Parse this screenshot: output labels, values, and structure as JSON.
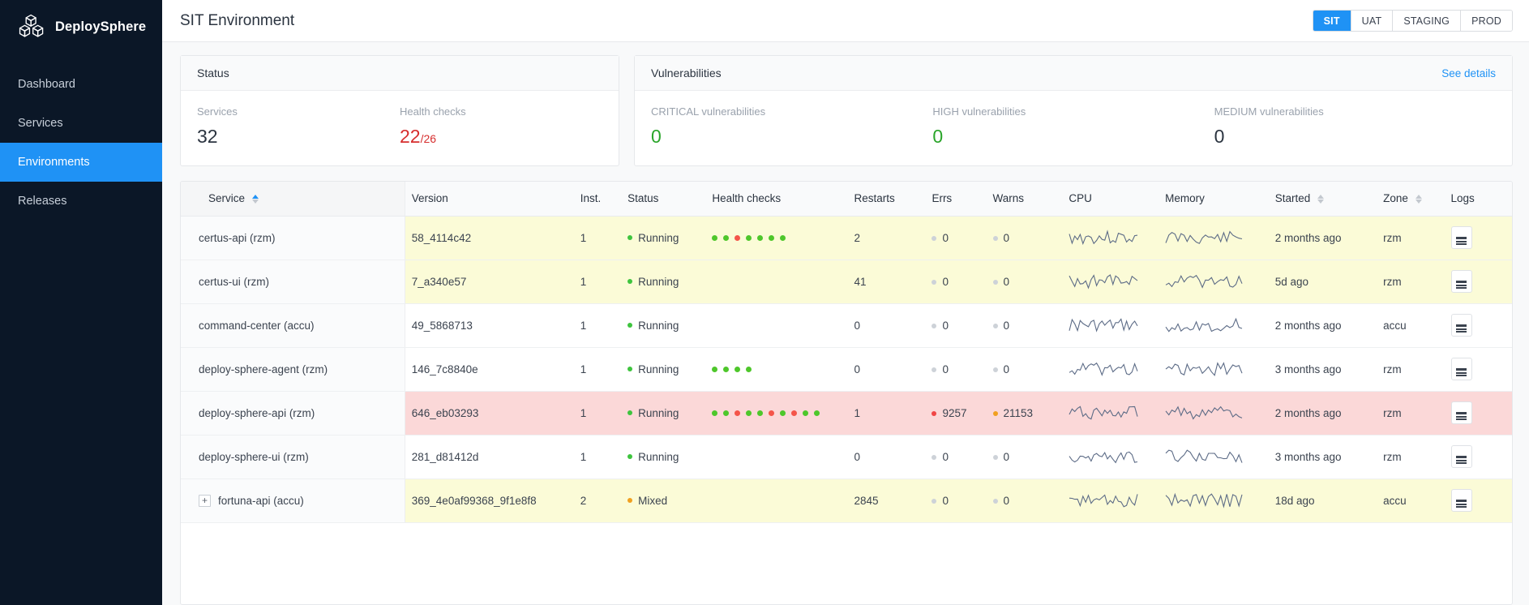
{
  "brand": {
    "name": "DeploySphere",
    "logo_icon": "cubes-logo-icon"
  },
  "sidebar": {
    "items": [
      {
        "label": "Dashboard",
        "active": false
      },
      {
        "label": "Services",
        "active": false
      },
      {
        "label": "Environments",
        "active": true
      },
      {
        "label": "Releases",
        "active": false
      }
    ]
  },
  "header": {
    "title": "SIT Environment",
    "env_tabs": [
      {
        "label": "SIT",
        "active": true
      },
      {
        "label": "UAT",
        "active": false
      },
      {
        "label": "STAGING",
        "active": false
      },
      {
        "label": "PROD",
        "active": false
      }
    ]
  },
  "status_card": {
    "title": "Status",
    "metrics": [
      {
        "label": "Services",
        "value": "32",
        "tone": "normal",
        "sub": ""
      },
      {
        "label": "Health checks",
        "value": "22",
        "tone": "red",
        "sub": "/26"
      }
    ]
  },
  "vuln_card": {
    "title": "Vulnerabilities",
    "link": "See details",
    "metrics": [
      {
        "label": "CRITICAL vulnerabilities",
        "value": "0",
        "tone": "green"
      },
      {
        "label": "HIGH vulnerabilities",
        "value": "0",
        "tone": "green"
      },
      {
        "label": "MEDIUM vulnerabilities",
        "value": "0",
        "tone": "normal"
      }
    ]
  },
  "table": {
    "columns": [
      {
        "label": "Service",
        "sort": "asc"
      },
      {
        "label": "Version",
        "sort": "none"
      },
      {
        "label": "Inst.",
        "sort": "none"
      },
      {
        "label": "Status",
        "sort": "none"
      },
      {
        "label": "Health checks",
        "sort": "none"
      },
      {
        "label": "Restarts",
        "sort": "none"
      },
      {
        "label": "Errs",
        "sort": "none"
      },
      {
        "label": "Warns",
        "sort": "none"
      },
      {
        "label": "CPU",
        "sort": "none"
      },
      {
        "label": "Memory",
        "sort": "none"
      },
      {
        "label": "Started",
        "sort": "inactive"
      },
      {
        "label": "Zone",
        "sort": "inactive"
      },
      {
        "label": "Logs",
        "sort": "none"
      }
    ],
    "rows": [
      {
        "service": "certus-api (rzm)",
        "expandable": false,
        "version": "58_4114c42",
        "inst": "1",
        "status": "Running",
        "status_tone": "green",
        "health": [
          "ok",
          "ok",
          "bad",
          "ok",
          "ok",
          "ok",
          "ok"
        ],
        "restarts": "2",
        "errs": "0",
        "errs_tone": "gray",
        "warns": "0",
        "warns_tone": "gray",
        "started": "2 months ago",
        "zone": "rzm",
        "highlight": "warn"
      },
      {
        "service": "certus-ui (rzm)",
        "expandable": false,
        "version": "7_a340e57",
        "inst": "1",
        "status": "Running",
        "status_tone": "green",
        "health": [],
        "restarts": "41",
        "errs": "0",
        "errs_tone": "gray",
        "warns": "0",
        "warns_tone": "gray",
        "started": "5d ago",
        "zone": "rzm",
        "highlight": "warn"
      },
      {
        "service": "command-center (accu)",
        "expandable": false,
        "version": "49_5868713",
        "inst": "1",
        "status": "Running",
        "status_tone": "green",
        "health": [],
        "restarts": "0",
        "errs": "0",
        "errs_tone": "gray",
        "warns": "0",
        "warns_tone": "gray",
        "started": "2 months ago",
        "zone": "accu",
        "highlight": "none"
      },
      {
        "service": "deploy-sphere-agent (rzm)",
        "expandable": false,
        "version": "146_7c8840e",
        "inst": "1",
        "status": "Running",
        "status_tone": "green",
        "health": [
          "ok",
          "ok",
          "ok",
          "ok"
        ],
        "restarts": "0",
        "errs": "0",
        "errs_tone": "gray",
        "warns": "0",
        "warns_tone": "gray",
        "started": "3 months ago",
        "zone": "rzm",
        "highlight": "none"
      },
      {
        "service": "deploy-sphere-api (rzm)",
        "expandable": false,
        "version": "646_eb03293",
        "inst": "1",
        "status": "Running",
        "status_tone": "green",
        "health": [
          "ok",
          "ok",
          "bad",
          "ok",
          "ok",
          "bad",
          "ok",
          "bad",
          "ok",
          "ok"
        ],
        "restarts": "1",
        "errs": "9257",
        "errs_tone": "red",
        "warns": "21153",
        "warns_tone": "orange",
        "started": "2 months ago",
        "zone": "rzm",
        "highlight": "err"
      },
      {
        "service": "deploy-sphere-ui (rzm)",
        "expandable": false,
        "version": "281_d81412d",
        "inst": "1",
        "status": "Running",
        "status_tone": "green",
        "health": [],
        "restarts": "0",
        "errs": "0",
        "errs_tone": "gray",
        "warns": "0",
        "warns_tone": "gray",
        "started": "3 months ago",
        "zone": "rzm",
        "highlight": "none"
      },
      {
        "service": "fortuna-api (accu)",
        "expandable": true,
        "version": "369_4e0af99368_9f1e8f8",
        "inst": "2",
        "status": "Mixed",
        "status_tone": "orange",
        "health": [],
        "restarts": "2845",
        "errs": "0",
        "errs_tone": "gray",
        "warns": "0",
        "warns_tone": "gray",
        "started": "18d ago",
        "zone": "accu",
        "highlight": "warn"
      }
    ]
  },
  "colors": {
    "accent": "#1f92f5",
    "sidebar_bg": "#0b1727",
    "ok": "#4ec72b",
    "bad": "#f4554a",
    "warn_row": "#fbfbd7",
    "err_row": "#fbd8d8",
    "red_text": "#d62e2e",
    "green_text": "#2aa52a"
  }
}
